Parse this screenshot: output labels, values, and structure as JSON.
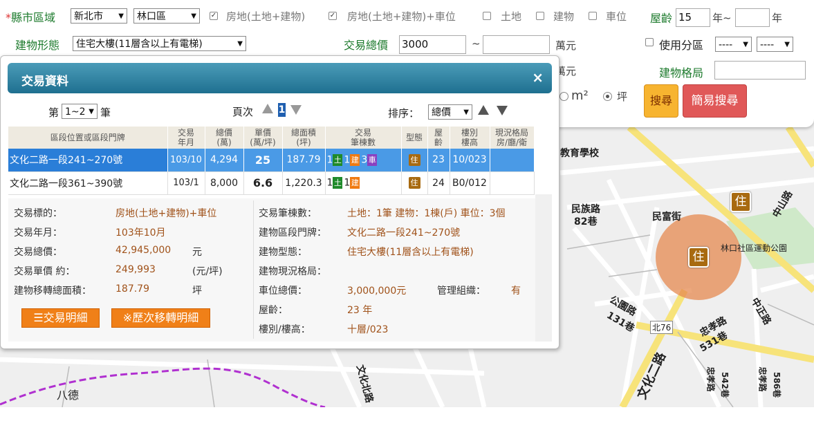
{
  "search": {
    "region_label": "縣市區域",
    "required_mark": "*",
    "city_value": "新北市",
    "district_value": "林口區",
    "checkboxes": [
      {
        "label": "房地(土地+建物)",
        "checked": true
      },
      {
        "label": "房地(土地+建物)+車位",
        "checked": true
      },
      {
        "label": "土地",
        "checked": false
      },
      {
        "label": "建物",
        "checked": false
      },
      {
        "label": "車位",
        "checked": false
      }
    ],
    "age_label": "屋齡",
    "age_from": "15",
    "age_sep": "年~",
    "age_to": "",
    "age_unit": "年",
    "building_type_label": "建物形態",
    "building_type_value": "住宅大樓(11層含以上有電梯)",
    "total_price_label": "交易總價",
    "total_price_from": "3000",
    "total_price_sep": "~",
    "total_price_to": "",
    "total_price_unit": "萬元",
    "unit_price_unit": "萬元",
    "zoning_label": "使用分區",
    "zoning_a": "----",
    "zoning_b": "----",
    "layout_label": "建物格局",
    "layout_value": "",
    "area_unit_m2": "m²",
    "area_unit_ping": "坪",
    "search_button": "搜尋",
    "simple_search_button": "簡易搜尋"
  },
  "dialog": {
    "title": "交易資料",
    "close": "×",
    "page_prefix": "第",
    "page_range": "1~2",
    "page_suffix": "筆",
    "page_label": "頁次",
    "page_number": "1",
    "sort_label": "排序：",
    "sort_value": "總價",
    "columns": [
      "區段位置或區段門牌",
      "交易\n年月",
      "總價\n(萬)",
      "單價\n(萬/坪)",
      "總面積\n(坪)",
      "交易\n筆棟數",
      "型態",
      "屋\n齡",
      "樓別\n樓高",
      "現況格局\n房/廳/衛"
    ],
    "rows": [
      {
        "location": "文化二路一段241~270號",
        "date": "103/10",
        "total": "4,294",
        "unit": "25",
        "area": "187.79",
        "count_land": "1",
        "land_tag": "土",
        "count_bldg": "1",
        "bldg_tag": "建",
        "count_car": "3",
        "car_tag": "車",
        "type_tag": "住",
        "age": "23",
        "floor": "10/023",
        "layout": ""
      },
      {
        "location": "文化二路一段361~390號",
        "date": "103/1",
        "total": "8,000",
        "unit": "6.6",
        "area": "1,220.3",
        "count_land": "1",
        "land_tag": "土",
        "count_bldg": "1",
        "bldg_tag": "建",
        "type_tag": "住",
        "age": "24",
        "floor": "B0/012",
        "layout": ""
      }
    ],
    "detail": {
      "target_label": "交易標的：",
      "target_value": "房地(土地+建物)+車位",
      "date_label": "交易年月：",
      "date_value": "103年10月",
      "total_label": "交易總價：",
      "total_value": "42,945,000",
      "total_unit": "元",
      "unitprice_label": "交易單價 約：",
      "unitprice_value": "249,993",
      "unitprice_unit": "(元/坪)",
      "area_label": "建物移轉總面積：",
      "area_value": "187.79",
      "area_unit": "坪",
      "count_label": "交易筆棟數：",
      "count_value": "土地：1筆 建物：1棟(戶) 車位：3個",
      "address_label": "建物區段門牌：",
      "address_value": "文化二路一段241~270號",
      "btype_label": "建物型態：",
      "btype_value": "住宅大樓(11層含以上有電梯)",
      "layout_label": "建物現況格局：",
      "parking_label": "車位總價：",
      "parking_value": "3,000,000元",
      "mgmt_label": "管理組織：",
      "mgmt_value": "有",
      "age_label": "屋齡：",
      "age_value": "23 年",
      "floor_label": "樓別/樓高：",
      "floor_value": "十層/023",
      "detail_button": "交易明細",
      "history_button": "※歷次移轉明細"
    }
  },
  "map": {
    "labels": [
      "教育學校",
      "民族路",
      "82巷",
      "民富街",
      "林口社區運動公園",
      "公園路",
      "131巷",
      "北76",
      "忠孝路",
      "531巷",
      "文化二路",
      "文化北路",
      "中山路",
      "中正路",
      "忠孝路",
      "542巷",
      "忠孝路",
      "586巷",
      "八德"
    ],
    "marker_tag": "住"
  }
}
